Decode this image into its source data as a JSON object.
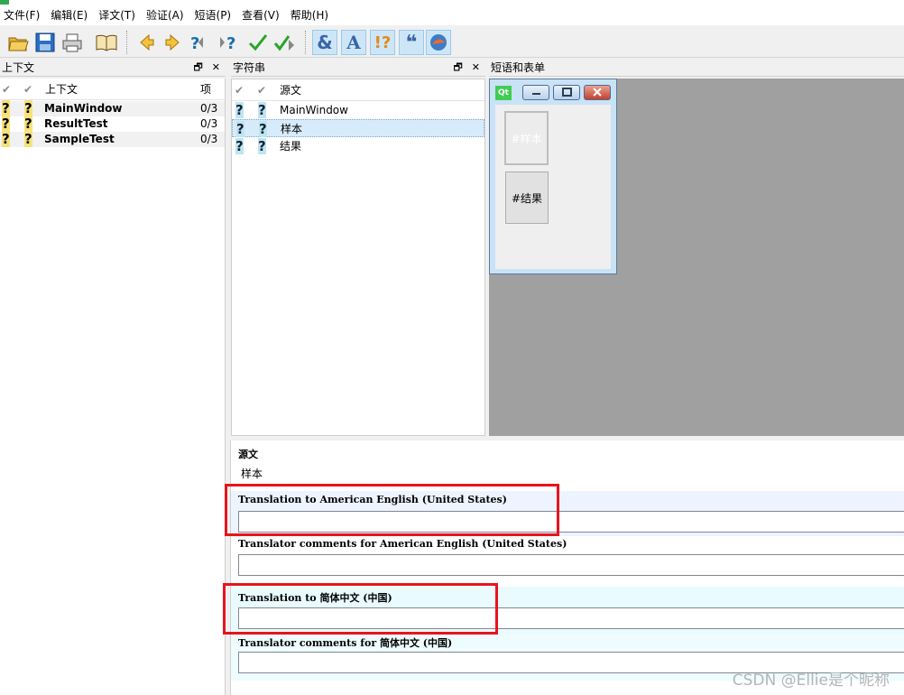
{
  "menubar": {
    "items": [
      "文件(F)",
      "编辑(E)",
      "译文(T)",
      "验证(A)",
      "短语(P)",
      "查看(V)",
      "帮助(H)"
    ]
  },
  "toolbar": {
    "icons": [
      "open-icon",
      "save-icon",
      "print-icon",
      "phrasebook-icon",
      "prev-icon",
      "next-icon",
      "prev-unfinished-icon",
      "next-unfinished-icon",
      "done-icon",
      "done-next-icon",
      "accelerator-check-icon",
      "punctuation-check-icon",
      "phrase-check-icon",
      "placemarker-check-icon",
      "surrounding-whitespace-icon"
    ]
  },
  "context_dock": {
    "title": "上下文",
    "header": {
      "name": "上下文",
      "count": "项"
    },
    "items": [
      {
        "name": "MainWindow",
        "count": "0/3"
      },
      {
        "name": "ResultTest",
        "count": "0/3"
      },
      {
        "name": "SampleTest",
        "count": "0/3"
      }
    ]
  },
  "strings_dock": {
    "title": "字符串",
    "header": {
      "source": "源文"
    },
    "items": [
      {
        "text": "MainWindow"
      },
      {
        "text": "样本"
      },
      {
        "text": "结果"
      }
    ]
  },
  "forms_dock": {
    "title": "短语和表单",
    "preview": {
      "logo": "Qt",
      "button1": "#样本",
      "button2": "#结果"
    }
  },
  "editor": {
    "source_label": "源文",
    "source_text": "样本",
    "translation_en_label": "Translation to American English (United States)",
    "comments_en_label": "Translator comments for American English (United States)",
    "translation_zh_label": "Translation to 简体中文 (中国)",
    "comments_zh_label": "Translator comments for 简体中文 (中国)"
  },
  "watermark": "CSDN @Ellie是个昵称",
  "colors": {
    "highlight_red": "#e8141c",
    "selection_blue": "#d8ebfb",
    "form_bg": "#a0a0a0"
  }
}
